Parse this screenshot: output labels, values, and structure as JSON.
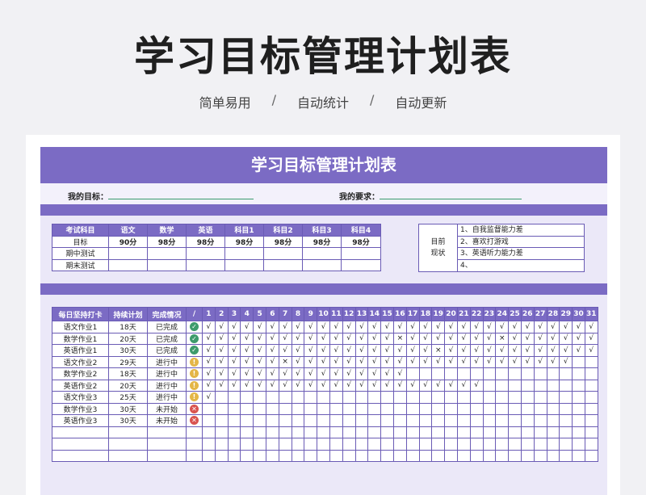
{
  "hero": {
    "title": "学习目标管理计划表",
    "tags": [
      "简单易用",
      "自动统计",
      "自动更新"
    ],
    "separator": "/"
  },
  "sheet": {
    "banner": "学习目标管理计划表",
    "goal_label": "我的目标：",
    "require_label": "我的要求：",
    "score_table": {
      "headers": [
        "考试科目",
        "语文",
        "数学",
        "英语",
        "科目1",
        "科目2",
        "科目3",
        "科目4"
      ],
      "rows": [
        [
          "目标",
          "90分",
          "98分",
          "98分",
          "98分",
          "98分",
          "98分",
          "98分"
        ],
        [
          "期中测试",
          "",
          "",
          "",
          "",
          "",
          "",
          ""
        ],
        [
          "期末测试",
          "",
          "",
          "",
          "",
          "",
          "",
          ""
        ]
      ]
    },
    "status": {
      "label_line1": "目前",
      "label_line2": "现状",
      "items": [
        "1、自我监督能力差",
        "2、喜欢打游戏",
        "3、英语听力能力差",
        "4、"
      ]
    },
    "checkin": {
      "headers": [
        "每日坚持打卡",
        "持续计划",
        "完成情况",
        "/"
      ],
      "days": [
        "1",
        "2",
        "3",
        "4",
        "5",
        "6",
        "7",
        "8",
        "9",
        "10",
        "11",
        "12",
        "13",
        "14",
        "15",
        "16",
        "17",
        "18",
        "19",
        "20",
        "21",
        "22",
        "23",
        "24",
        "25",
        "26",
        "27",
        "28",
        "29",
        "30",
        "31"
      ],
      "status_colors": {
        "已完成": "#3d9b6c",
        "进行中": "#e4b647",
        "未开始": "#d9534f"
      },
      "rows": [
        {
          "task": "语文作业1",
          "plan": "18天",
          "state": "已完成",
          "icon": "done",
          "marks": "√√√√√√√√√√√√√√√√√√√√√√√√√√√√√√√"
        },
        {
          "task": "数学作业1",
          "plan": "20天",
          "state": "已完成",
          "icon": "done",
          "marks": "√√√√√√√√√√√√√√√×√√√√√√√×√√√√√√√"
        },
        {
          "task": "英语作业1",
          "plan": "30天",
          "state": "已完成",
          "icon": "done",
          "marks": "√√√√√√√√√√√√√√√√√√×√√√√√√√√√√√√"
        },
        {
          "task": "语文作业2",
          "plan": "29天",
          "state": "进行中",
          "icon": "prog",
          "marks": "√√√√√√×√√√√√√√√√√√√√√√√√√√√√√"
        },
        {
          "task": "数学作业2",
          "plan": "18天",
          "state": "进行中",
          "icon": "prog",
          "marks": "√√√√√√√√√√√√√√√√"
        },
        {
          "task": "英语作业2",
          "plan": "20天",
          "state": "进行中",
          "icon": "prog",
          "marks": "√√√√√√√√√√√√√√√√√√√√√√"
        },
        {
          "task": "语文作业3",
          "plan": "25天",
          "state": "进行中",
          "icon": "prog",
          "marks": "√"
        },
        {
          "task": "数学作业3",
          "plan": "30天",
          "state": "未开始",
          "icon": "todo",
          "marks": ""
        },
        {
          "task": "英语作业3",
          "plan": "30天",
          "state": "未开始",
          "icon": "todo",
          "marks": ""
        }
      ],
      "empty_rows": 3
    }
  }
}
